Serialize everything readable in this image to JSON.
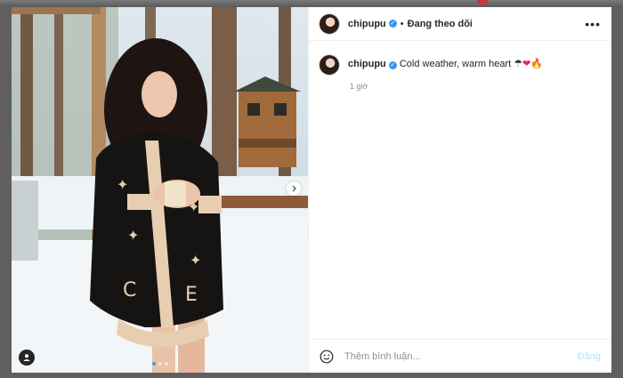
{
  "post": {
    "author": "chipupu",
    "follow_status": "Đang theo dõi",
    "separator": "•",
    "caption": "Cold weather, warm heart",
    "caption_emojis": {
      "umbrella": "☂",
      "heart": "❤",
      "fire": "🔥"
    },
    "time_ago": "1 giờ",
    "carousel": {
      "total": 3,
      "current": 1
    }
  },
  "comment_box": {
    "placeholder": "Thêm bình luận...",
    "post_label": "Đăng"
  },
  "icons": {
    "more": "more-options-icon",
    "smile": "emoji-icon",
    "next": "chevron-right-icon",
    "tag": "user-tag-icon",
    "verified": "verified-badge-icon"
  },
  "colors": {
    "verified": "#3797f0",
    "post_button_disabled": "#b2dffc",
    "carousel_active_dot": "#3797f0"
  }
}
